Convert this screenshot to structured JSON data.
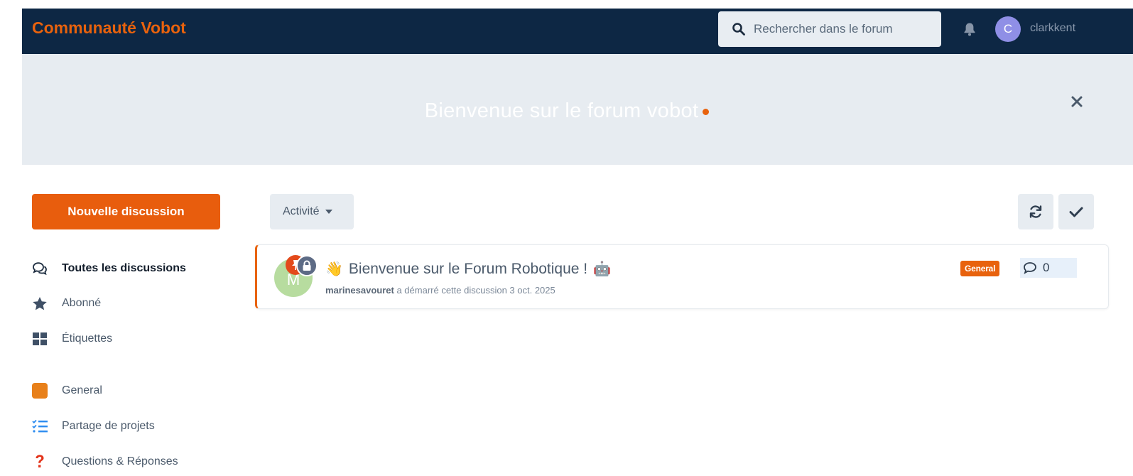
{
  "header": {
    "brand": "Communauté Vobot",
    "search_placeholder": "Rechercher dans le forum",
    "avatar_initial": "C",
    "username": "clarkkent",
    "colors": {
      "background": "#0d2744",
      "brand": "#e8620d",
      "avatar": "#8f8fe6"
    }
  },
  "hero": {
    "title": "Bienvenue sur le forum vobot",
    "close_icon": "close-icon"
  },
  "sidebar": {
    "new_discussion": "Nouvelle discussion",
    "items": [
      {
        "label": "Toutes les discussions",
        "icon": "comments-icon",
        "active": true
      },
      {
        "label": "Abonné",
        "icon": "star-icon"
      },
      {
        "label": "Étiquettes",
        "icon": "tags-grid-icon"
      },
      {
        "label": "General",
        "icon": "tag-square-icon",
        "color": "#e8801a"
      },
      {
        "label": "Partage de projets",
        "icon": "list-check-icon",
        "color": "#2d8cf0"
      },
      {
        "label": "Questions & Réponses",
        "icon": "question-icon",
        "color": "#e3341b"
      }
    ]
  },
  "toolbar": {
    "sort_label": "Activité",
    "refresh_icon": "refresh-icon",
    "mark_read_icon": "check-icon"
  },
  "discussions": [
    {
      "avatar_initial": "M",
      "emoji_start": "👋",
      "title": "Bienvenue sur le Forum Robotique !",
      "emoji_end": "🤖",
      "author": "marinesavouret",
      "meta": "a démarré cette discussion 3 oct. 2025",
      "tag": "General",
      "reply_count": "0",
      "pinned": true,
      "locked": true
    }
  ]
}
